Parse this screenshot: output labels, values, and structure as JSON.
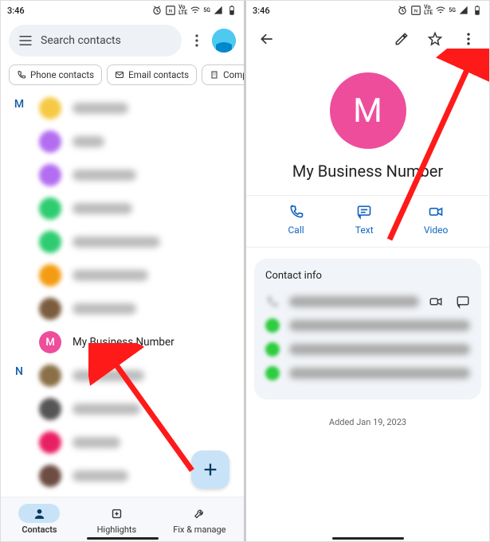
{
  "status": {
    "time": "3:46",
    "lte": "5G",
    "nfc": "N"
  },
  "left": {
    "search_placeholder": "Search contacts",
    "chips": {
      "phone": "Phone contacts",
      "email": "Email contacts",
      "company": "Compan"
    },
    "sections": {
      "m": "M",
      "n": "N"
    },
    "business_contact": {
      "letter": "M",
      "name": "My Business Number"
    },
    "nav": {
      "contacts": "Contacts",
      "highlights": "Highlights",
      "fixmanage": "Fix & manage"
    }
  },
  "right": {
    "avatar_letter": "M",
    "contact_name": "My Business Number",
    "actions": {
      "call": "Call",
      "text": "Text",
      "video": "Video"
    },
    "info_title": "Contact info",
    "added": "Added Jan 19, 2023"
  }
}
